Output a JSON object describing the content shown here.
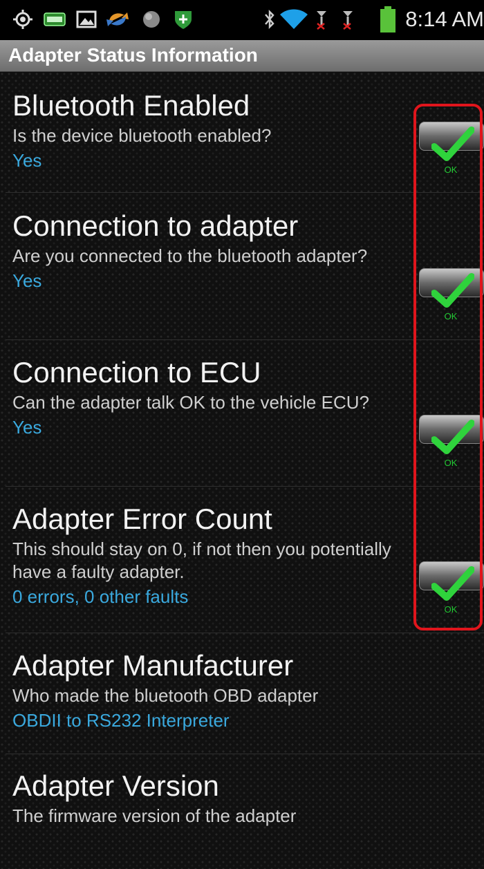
{
  "status_bar": {
    "time": "8:14 AM",
    "icons": [
      "gps-icon",
      "obd-icon",
      "gallery-icon",
      "sync-icon",
      "globe-icon",
      "shield-icon",
      "bluetooth-icon",
      "wifi-icon",
      "signal-icon",
      "signal-icon",
      "battery-icon"
    ]
  },
  "header": {
    "title": "Adapter Status Information"
  },
  "rows": [
    {
      "title": "Bluetooth Enabled",
      "desc": "Is the device bluetooth enabled?",
      "value": "Yes",
      "status": "OK"
    },
    {
      "title": "Connection to adapter",
      "desc": "Are you connected to the bluetooth adapter?",
      "value": "Yes",
      "status": "OK"
    },
    {
      "title": "Connection to ECU",
      "desc": "Can the adapter talk OK to the vehicle ECU?",
      "value": "Yes",
      "status": "OK"
    },
    {
      "title": "Adapter Error Count",
      "desc": "This should stay on 0, if not then you potentially have a faulty adapter.",
      "value": "0 errors, 0 other faults",
      "status": "OK"
    },
    {
      "title": "Adapter Manufacturer",
      "desc": "Who made the bluetooth OBD adapter",
      "value": "OBDII to RS232 Interpreter"
    },
    {
      "title": "Adapter Version",
      "desc": "The firmware version of the adapter"
    }
  ],
  "colors": {
    "accent": "#3aa9de",
    "ok_green": "#22c833",
    "highlight": "#e0151c"
  }
}
